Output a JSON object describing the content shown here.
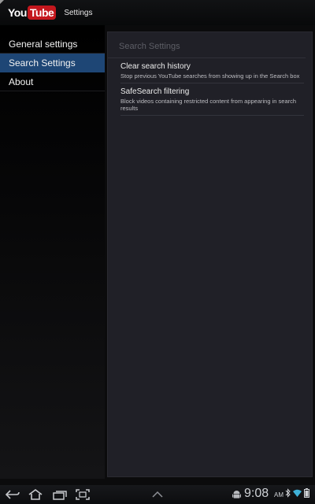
{
  "app": {
    "logo_you": "You",
    "logo_tube": "Tube",
    "title": "Settings"
  },
  "sidebar": {
    "items": [
      {
        "label": "General settings",
        "selected": false
      },
      {
        "label": "Search Settings",
        "selected": true
      },
      {
        "label": "About",
        "selected": false
      }
    ]
  },
  "panel": {
    "header": "Search Settings",
    "prefs": [
      {
        "title": "Clear search history",
        "summary": "Stop previous YouTube searches from showing up in the Search box"
      },
      {
        "title": "SafeSearch filtering",
        "summary": "Block videos containing restricted content from appearing in search results"
      }
    ]
  },
  "systembar": {
    "clock": "9:08",
    "ampm": "AM",
    "icons": [
      "back-icon",
      "home-icon",
      "recent-apps-icon",
      "screenshot-icon",
      "up-chevron-icon",
      "android-icon",
      "bluetooth-icon",
      "wifi-icon",
      "battery-icon"
    ]
  },
  "colors": {
    "accent": "#1e4675",
    "brand_red": "#c4171d",
    "panel_bg": "#202027"
  }
}
